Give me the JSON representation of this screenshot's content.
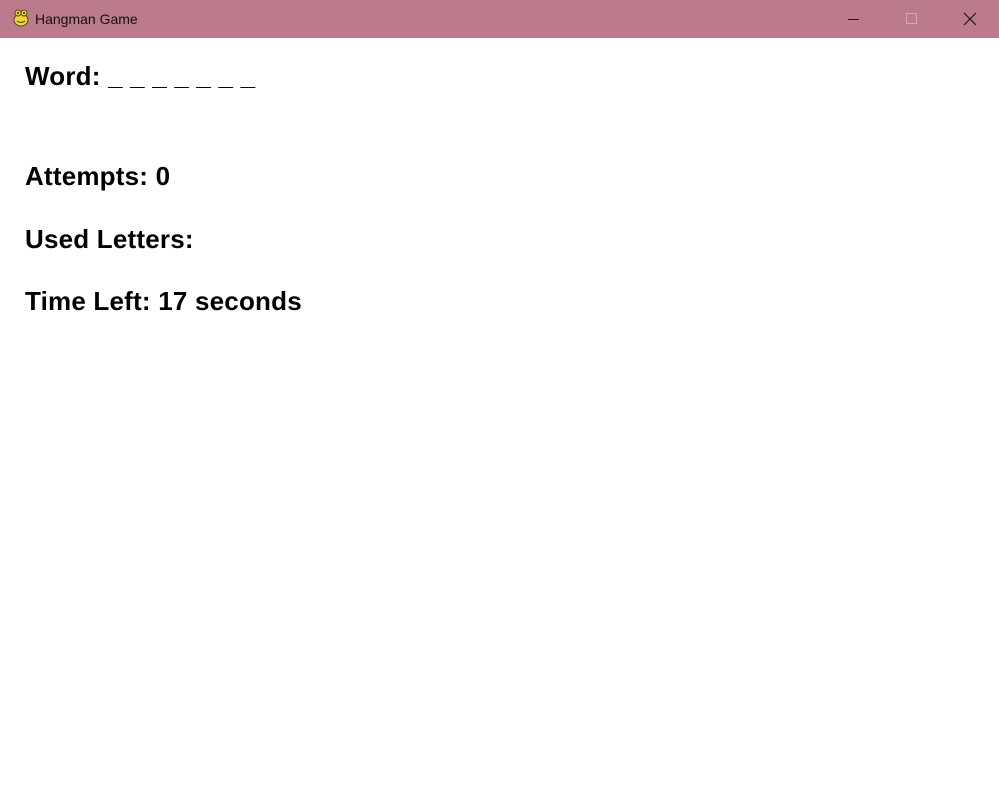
{
  "window": {
    "title": "Hangman Game",
    "icon": "pygame-snake-icon",
    "titlebar_color": "#bc7b8d",
    "controls": {
      "minimize_icon": "minimize-icon",
      "maximize_icon": "maximize-icon",
      "close_icon": "close-icon"
    }
  },
  "game": {
    "word_label": "Word:",
    "word_display": "_ _ _ _ _ _ _",
    "attempts_label": "Attempts:",
    "attempts_value": "0",
    "used_letters_label": "Used Letters:",
    "used_letters_value": "",
    "time_left_label": "Time Left:",
    "time_left_value": "17",
    "time_left_unit": "seconds"
  }
}
